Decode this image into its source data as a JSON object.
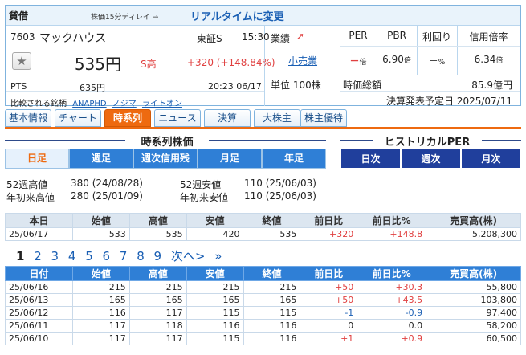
{
  "header": {
    "kashi": "貸借",
    "delay_note": "株価15分ディレイ →",
    "realtime_link": "リアルタイムに変更"
  },
  "stock": {
    "code": "7603",
    "name": "マックハウス",
    "exchange": "東証S",
    "time": "15:30",
    "price": "535円",
    "s_high": "S高",
    "change": "+320 (+148.84%)",
    "pts_label": "PTS",
    "pts_price": "635円",
    "pts_time": "20:23  06/17",
    "compare_label": "比較される銘柄",
    "compare": [
      "ANAPHD",
      "ノジマ",
      "ライトオン"
    ],
    "gyoseki_label": "業績",
    "sector": "小売業",
    "unit": "単位 100株",
    "metric_headers": [
      "PER",
      "PBR",
      "利回り",
      "信用倍率"
    ],
    "metric_values": [
      "－",
      "6.90",
      "－",
      "6.34"
    ],
    "metric_units": [
      "倍",
      "倍",
      "%",
      "倍"
    ],
    "market_cap_label": "時価総額",
    "market_cap": "85.9億円",
    "earnings_date": "決算発表予定日  2025/07/11"
  },
  "tabs": [
    "基本情報",
    "チャート",
    "時系列",
    "ニュース",
    "決算",
    "大株主",
    "株主優待"
  ],
  "active_tab": "時系列",
  "timeseries": {
    "title": "時系列株価",
    "freq_tabs": [
      "日足",
      "週足",
      "週次信用残",
      "月足",
      "年足"
    ],
    "selected_freq": "日足"
  },
  "historical_per": {
    "title": "ヒストリカルPER",
    "tabs": [
      "日次",
      "週次",
      "月次"
    ]
  },
  "ranges": {
    "wk52_high_label": "52週高値",
    "wk52_high": "380 (24/08/28)",
    "ytd_high_label": "年初来高値",
    "ytd_high": "280 (25/01/09)",
    "wk52_low_label": "52週安値",
    "wk52_low": "110 (25/06/03)",
    "ytd_low_label": "年初来安値",
    "ytd_low": "110 (25/06/03)"
  },
  "today_table": {
    "headers": [
      "本日",
      "始値",
      "高値",
      "安値",
      "終値",
      "前日比",
      "前日比%",
      "売買高(株)"
    ],
    "row": [
      "25/06/17",
      "533",
      "535",
      "420",
      "535",
      "+320",
      "+148.8",
      "5,208,300"
    ]
  },
  "pager": {
    "pages": [
      "1",
      "2",
      "3",
      "4",
      "5",
      "6",
      "7",
      "8",
      "9"
    ],
    "next": "次へ>",
    "last": "»"
  },
  "daily_table": {
    "headers": [
      "日付",
      "始値",
      "高値",
      "安値",
      "終値",
      "前日比",
      "前日比%",
      "売買高(株)"
    ],
    "rows": [
      [
        "25/06/16",
        "215",
        "215",
        "215",
        "215",
        "+50",
        "+30.3",
        "55,800"
      ],
      [
        "25/06/13",
        "165",
        "165",
        "165",
        "165",
        "+50",
        "+43.5",
        "103,800"
      ],
      [
        "25/06/12",
        "116",
        "117",
        "115",
        "115",
        "-1",
        "-0.9",
        "97,400"
      ],
      [
        "25/06/11",
        "117",
        "118",
        "116",
        "116",
        "0",
        "0.0",
        "58,200"
      ],
      [
        "25/06/10",
        "117",
        "117",
        "115",
        "116",
        "+1",
        "+0.9",
        "60,500"
      ]
    ]
  },
  "colors": {
    "accent": "#ee6a10",
    "up": "#e04040",
    "down": "#1a5fb4",
    "header_blue": "#2f7fd6",
    "navy": "#203f9c"
  }
}
